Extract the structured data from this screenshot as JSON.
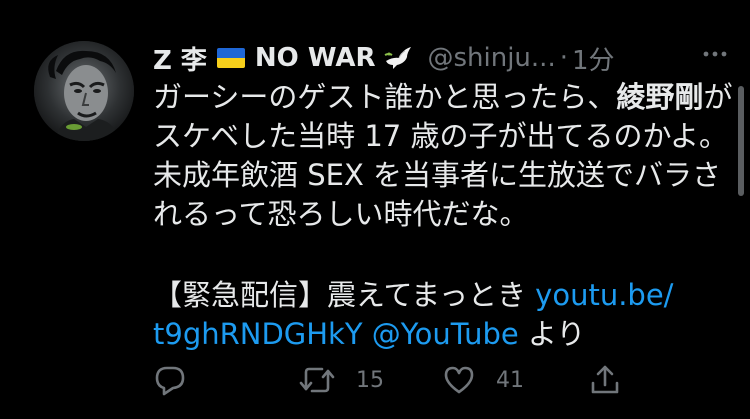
{
  "tweet": {
    "display_name_prefix": "Z 李",
    "display_name_suffix": "NO WAR",
    "handle": "@shinju...",
    "separator": "·",
    "time": "1分",
    "lines": [
      {
        "parts": [
          {
            "text": "ガーシーのゲスト誰かと思ったら、",
            "style": "normal"
          },
          {
            "text": "綾野剛",
            "style": "bold"
          },
          {
            "text": "が",
            "style": "normal"
          }
        ]
      },
      {
        "parts": [
          {
            "text": "スケベした当時 17 歳の子が出てるのかよ。",
            "style": "normal"
          }
        ]
      },
      {
        "parts": [
          {
            "text": "未成年飲酒 SEX を当事者に生放送でバラさ",
            "style": "normal"
          }
        ]
      },
      {
        "parts": [
          {
            "text": "れるって恐ろしい時代だな。",
            "style": "normal"
          }
        ]
      },
      {
        "parts": [
          {
            "text": "【緊急配信】震えてまっとき ",
            "style": "normal"
          },
          {
            "text": "youtu.be/",
            "style": "link"
          }
        ]
      },
      {
        "parts": [
          {
            "text": "t9ghRNDGHkY @YouTube",
            "style": "link"
          },
          {
            "text": " より",
            "style": "normal"
          }
        ]
      }
    ]
  },
  "actions": {
    "reply": {
      "icon": "reply-icon",
      "count": ""
    },
    "retweet": {
      "icon": "retweet-icon",
      "count": "15"
    },
    "like": {
      "icon": "heart-icon",
      "count": "41"
    },
    "share": {
      "icon": "share-icon",
      "count": ""
    }
  },
  "colors": {
    "background": "#000000",
    "text": "#e7e9ea",
    "muted": "#71767b",
    "link": "#1d9bf0",
    "flag_blue": "#1f67d6",
    "flag_yellow": "#f7cf1b"
  }
}
